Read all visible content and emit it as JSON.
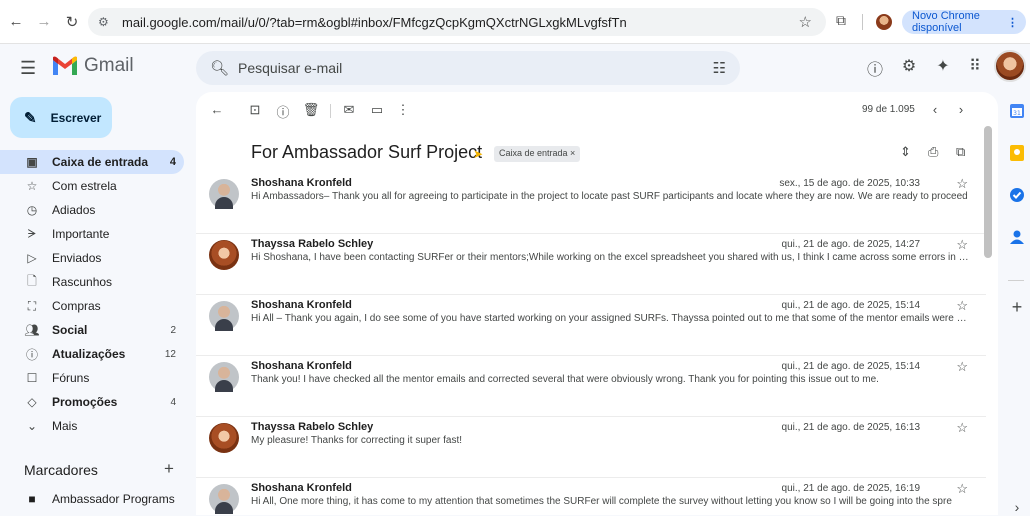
{
  "browser": {
    "url": "mail.google.com/mail/u/0/?tab=rm&ogbl#inbox/FMfcgzQcpKgmQXctrNGLxgkMLvgfsfTn",
    "update_label": "Novo Chrome disponível"
  },
  "gmail": {
    "logo_text": "Gmail",
    "search_placeholder": "Pesquisar e-mail"
  },
  "sidebar": {
    "compose_label": "Escrever",
    "items": [
      {
        "label": "Caixa de entrada",
        "count": "4",
        "icon": "inbox-icon"
      },
      {
        "label": "Com estrela",
        "count": "",
        "icon": "star-icon"
      },
      {
        "label": "Adiados",
        "count": "",
        "icon": "clock-icon"
      },
      {
        "label": "Importante",
        "count": "",
        "icon": "important-icon"
      },
      {
        "label": "Enviados",
        "count": "",
        "icon": "send-icon"
      },
      {
        "label": "Rascunhos",
        "count": "",
        "icon": "draft-icon"
      },
      {
        "label": "Compras",
        "count": "",
        "icon": "shopping-bag-icon"
      },
      {
        "label": "Social",
        "count": "2",
        "icon": "people-icon"
      },
      {
        "label": "Atualizações",
        "count": "12",
        "icon": "info-icon"
      },
      {
        "label": "Fóruns",
        "count": "",
        "icon": "forum-icon"
      },
      {
        "label": "Promoções",
        "count": "4",
        "icon": "tag-icon"
      },
      {
        "label": "Mais",
        "count": "",
        "icon": "chevron-down-icon"
      }
    ],
    "labels_title": "Marcadores",
    "label_items": [
      {
        "label": "Ambassador Programs",
        "icon": "label-icon"
      }
    ]
  },
  "thread": {
    "pager": "99 de 1.095",
    "subject": "For Ambassador Surf Project",
    "chip": "Caixa de entrada ×",
    "messages": [
      {
        "from": "Shoshana Kronfeld",
        "date": "sex., 15 de ago. de 2025, 10:33",
        "snippet": "Hi Ambassadors– Thank you all for agreeing to participate in the project to locate past SURF participants and locate where they are now. We are ready to proceed",
        "avatar": "shoshana"
      },
      {
        "from": "Thayssa Rabelo Schley",
        "date": "qui., 21 de ago. de 2025, 14:27",
        "snippet": "Hi Shoshana, I have been contacting SURFer or their mentors;While working on the excel spreadsheet you shared with us, I think I came across some errors in the",
        "avatar": "thayssa"
      },
      {
        "from": "Shoshana Kronfeld",
        "date": "qui., 21 de ago. de 2025, 15:14",
        "snippet": "Hi All – Thank you again, I do see some of you have started working on your assigned SURFs. Thayssa pointed out to me that some of the mentor emails were ob…",
        "avatar": "shoshana"
      },
      {
        "from": "Shoshana Kronfeld",
        "date": "qui., 21 de ago. de 2025, 15:14",
        "snippet": "Thank you! I have checked all the mentor emails and corrected several that were obviously wrong. Thank you for pointing this issue out to me.",
        "avatar": "shoshana"
      },
      {
        "from": "Thayssa Rabelo Schley",
        "date": "qui., 21 de ago. de 2025, 16:13",
        "snippet": "My pleasure! Thanks for correcting it super fast!",
        "avatar": "thayssa"
      },
      {
        "from": "Shoshana Kronfeld",
        "date": "qui., 21 de ago. de 2025, 16:19",
        "snippet": "Hi All, One more thing, it has come to my attention that sometimes the SURFer will complete the survey without letting you know so I will be going into the spre",
        "avatar": "shoshana"
      }
    ]
  },
  "colors": {
    "accent": "#0b57d0",
    "compose_bg": "#c2e7ff",
    "active_bg": "#d3e3fd",
    "label_arrow": "#f4b400"
  }
}
